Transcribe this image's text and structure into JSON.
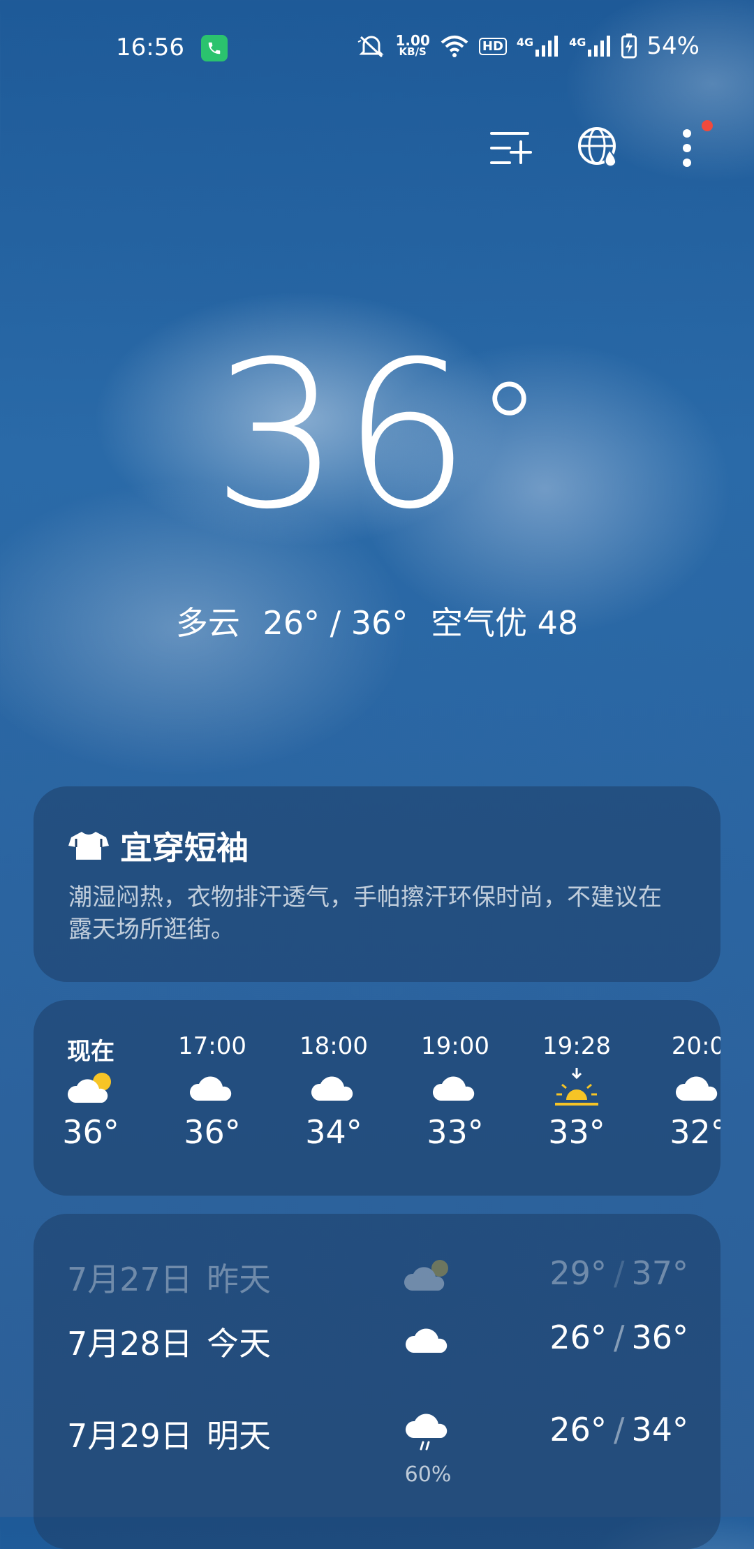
{
  "status_bar": {
    "time": "16:56",
    "net_speed_value": "1.00",
    "net_speed_unit": "KB/S",
    "hd_label": "HD",
    "signal1_label": "4G",
    "signal2_label": "4G",
    "battery": "54%",
    "icons": [
      "call-icon",
      "mute-icon",
      "wifi-icon",
      "signal-icon",
      "battery-charging-icon"
    ]
  },
  "toolbar": {
    "icons": [
      "add-city-icon",
      "globe-weather-icon",
      "more-icon"
    ],
    "notification_dot_color": "#f04a3c"
  },
  "current": {
    "temperature": "36",
    "degree_symbol": "°",
    "condition": "多云",
    "range": "26° / 36°",
    "air_quality": "空气优 48"
  },
  "advice": {
    "icon": "tshirt-icon",
    "title": "宜穿短袖",
    "text": "潮湿闷热，衣物排汗透气，手帕擦汗环保时尚，不建议在露天场所逛街。"
  },
  "hourly": [
    {
      "label": "现在",
      "icon": "partly-cloudy-icon",
      "temp": "36°"
    },
    {
      "label": "17:00",
      "icon": "cloudy-icon",
      "temp": "36°"
    },
    {
      "label": "18:00",
      "icon": "cloudy-icon",
      "temp": "34°"
    },
    {
      "label": "19:00",
      "icon": "cloudy-icon",
      "temp": "33°"
    },
    {
      "label": "19:28",
      "icon": "sunset-icon",
      "temp": "33°"
    },
    {
      "label": "20:0",
      "icon": "cloudy-icon",
      "temp": "32°"
    }
  ],
  "daily": [
    {
      "date": "7月27日",
      "day": "昨天",
      "icon": "partly-cloudy-icon",
      "low": "29°",
      "sep": "/",
      "high": "37°"
    },
    {
      "date": "7月28日",
      "day": "今天",
      "icon": "cloudy-icon",
      "low": "26°",
      "sep": "/",
      "high": "36°"
    },
    {
      "date": "7月29日",
      "day": "明天",
      "icon": "rain-icon",
      "low": "26°",
      "sep": "/",
      "high": "34°",
      "precip": "60%"
    }
  ],
  "colors": {
    "sun": "#f6c426",
    "call_badge": "#2bc36e"
  }
}
